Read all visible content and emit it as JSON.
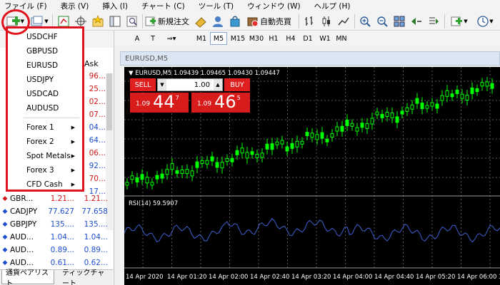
{
  "menu": [
    "ファイル (F)",
    "表示 (V)",
    "挿入 (I)",
    "チャート (C)",
    "ツール (T)",
    "ウィンドウ (W)",
    "ヘルプ (H)"
  ],
  "toolbar": {
    "new_order_label": "新規注文",
    "auto_trading_label": "自動売買",
    "timeframes": [
      "M1",
      "M5",
      "M15",
      "M30",
      "H1",
      "H4",
      "D1",
      "W1",
      "MN"
    ],
    "active_timeframe": "M5",
    "text_tool": "A",
    "label_tool": "T"
  },
  "market_watch": {
    "ask_header": "Ask",
    "right_strip": [
      "96...",
      "25...",
      "02...",
      "07...",
      "04...",
      "64...",
      "06...",
      "92...",
      "70...",
      "17..."
    ],
    "rows": [
      {
        "symbol": "GBR...",
        "bid": "1.21...",
        "ask": "1.21...",
        "dir": "up",
        "arrow": "◆"
      },
      {
        "symbol": "CADJPY",
        "bid": "77.627",
        "ask": "77.658",
        "dir": "up",
        "arrow": "◆"
      },
      {
        "symbol": "GBPJPY",
        "bid": "135....",
        "ask": "135....",
        "dir": "up",
        "arrow": "◆"
      },
      {
        "symbol": "AUD...",
        "bid": "1.04...",
        "ask": "1.04...",
        "dir": "up",
        "arrow": "◆"
      },
      {
        "symbol": "AUD...",
        "bid": "0.89...",
        "ask": "0.89...",
        "dir": "up",
        "arrow": "◆"
      },
      {
        "symbol": "AUD...",
        "bid": "0.61...",
        "ask": "0.62...",
        "dir": "up",
        "arrow": "◆"
      }
    ],
    "tabs": [
      "通貨ペアリスト",
      "ティックチャート"
    ]
  },
  "dropdown": {
    "symbols": [
      "USDCHF",
      "GBPUSD",
      "EURUSD",
      "USDJPY",
      "USDCAD",
      "AUDUSD"
    ],
    "groups": [
      "Forex 1",
      "Forex 2",
      "Spot Metals",
      "Forex 3",
      "CFD Cash"
    ]
  },
  "chart": {
    "window_title": "EURUSD,M5",
    "info_line": "▼ EURUSD,M5  1.09439 1.09465 1.09430 1.09447",
    "rsi_label": "RSI(14) 59.5907",
    "time_labels": [
      "14 Apr 2020",
      "14 Apr 01:20",
      "14 Apr 02:00",
      "14 Apr 02:40",
      "14 Apr 03:20",
      "14 Apr 04:00",
      "14 Apr 04:40",
      "14 Apr 05:20",
      "14 Apr 06:00",
      "14 Ap"
    ],
    "colors": {
      "background": "#000000",
      "candle": "#00ff00",
      "rsi": "#4060d0",
      "grid": "#5a5a5a"
    }
  },
  "one_click": {
    "sell_label": "SELL",
    "buy_label": "BUY",
    "lot": "1.00",
    "sell_price": {
      "prefix": "1.09",
      "big": "44",
      "sup": "7"
    },
    "buy_price": {
      "prefix": "1.09",
      "big": "46",
      "sup": "5"
    }
  }
}
